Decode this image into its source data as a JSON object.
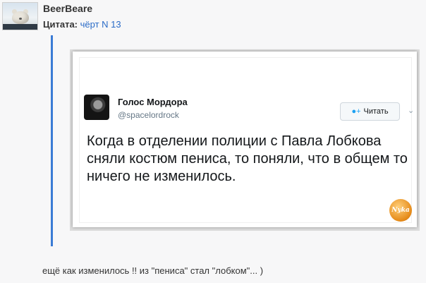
{
  "post": {
    "username": "BeerBeare",
    "quote_label": "Цитата:",
    "quote_source": "чёрт N 13",
    "comment": "ещё как изменилось !! из \"пениса\" стал \"лобком\"... )"
  },
  "tweet": {
    "author_name": "Голос Мордора",
    "author_handle": "@spacelordrock",
    "follow_label": "Читать",
    "follow_icon": "add-user-icon",
    "menu_icon": "chevron-down-icon",
    "text": "Когда в отделении полиции с Павла Лобкова сняли костюм пениса, то поняли, что в общем то ничего не изменилось.",
    "watermark": "Nyka"
  },
  "colors": {
    "link": "#2a6bc7",
    "quote_border": "#3a7bd5",
    "twitter_blue": "#1da1f2"
  }
}
